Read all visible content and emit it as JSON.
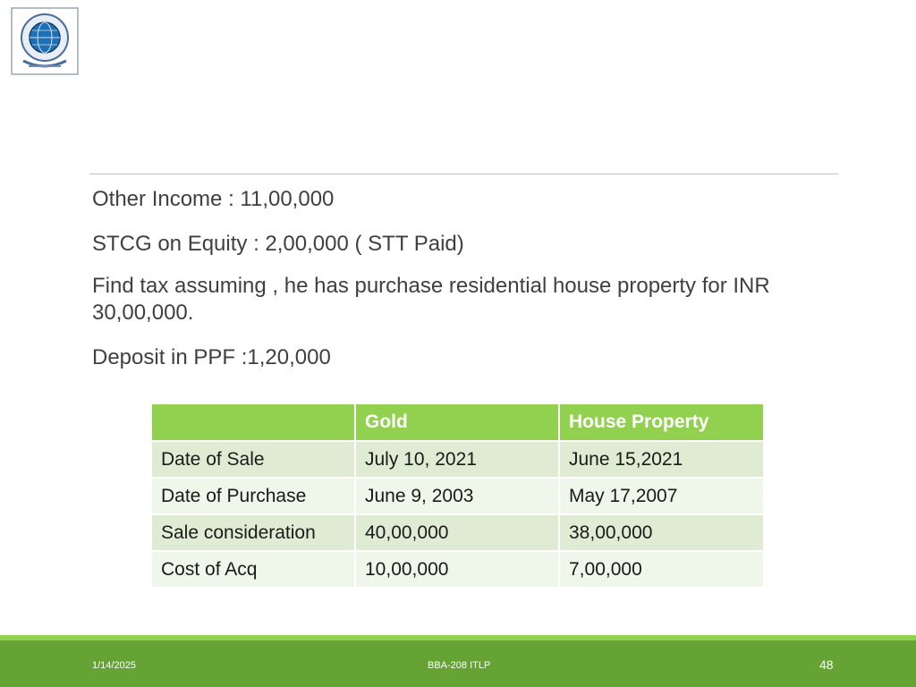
{
  "header": {
    "logo_icon": "institution-seal-icon"
  },
  "content": {
    "lines": [
      "Other Income : 11,00,000",
      "STCG on Equity : 2,00,000 ( STT Paid)",
      "Find tax assuming , he has purchase residential house property for INR 30,00,000.",
      "Deposit in PPF :1,20,000"
    ]
  },
  "table": {
    "headers": [
      "",
      "Gold",
      "House Property"
    ],
    "rows": [
      [
        "Date of Sale",
        "July 10, 2021",
        "June 15,2021"
      ],
      [
        "Date of Purchase",
        "June 9, 2003",
        "May 17,2007"
      ],
      [
        "Sale consideration",
        "40,00,000",
        "38,00,000"
      ],
      [
        "Cost of Acq",
        "10,00,000",
        "7,00,000"
      ]
    ]
  },
  "footer": {
    "date": "1/14/2025",
    "course": "BBA-208 ITLP",
    "page": "48"
  },
  "colors": {
    "header_green": "#92d050",
    "footer_green": "#64a334",
    "row_odd": "#dfecd3",
    "row_even": "#eff6ea"
  }
}
